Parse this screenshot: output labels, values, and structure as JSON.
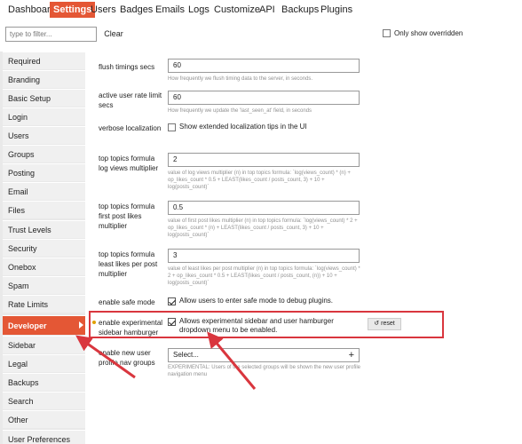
{
  "nav": {
    "tabs": [
      {
        "label": "Dashboard",
        "active": false
      },
      {
        "label": "Settings",
        "active": true
      },
      {
        "label": "Users",
        "active": false
      },
      {
        "label": "Badges",
        "active": false
      },
      {
        "label": "Emails",
        "active": false
      },
      {
        "label": "Logs",
        "active": false
      },
      {
        "label": "Customize",
        "active": false
      },
      {
        "label": "API",
        "active": false
      },
      {
        "label": "Backups",
        "active": false
      },
      {
        "label": "Plugins",
        "active": false
      }
    ]
  },
  "filter": {
    "placeholder": "type to filter...",
    "clear_label": "Clear",
    "only_overridden_label": "Only show overridden",
    "only_overridden_checked": false
  },
  "sidebar": {
    "items": [
      {
        "label": "Required"
      },
      {
        "label": "Branding"
      },
      {
        "label": "Basic Setup"
      },
      {
        "label": "Login"
      },
      {
        "label": "Users"
      },
      {
        "label": "Groups"
      },
      {
        "label": "Posting"
      },
      {
        "label": "Email"
      },
      {
        "label": "Files"
      },
      {
        "label": "Trust Levels"
      },
      {
        "label": "Security"
      },
      {
        "label": "Onebox"
      },
      {
        "label": "Spam"
      },
      {
        "label": "Rate Limits"
      },
      {
        "label": "Developer",
        "active": true
      },
      {
        "label": "Sidebar"
      },
      {
        "label": "Legal"
      },
      {
        "label": "Backups"
      },
      {
        "label": "Search"
      },
      {
        "label": "Other"
      },
      {
        "label": "User Preferences"
      }
    ]
  },
  "settings": {
    "flush_timings": {
      "label": "flush timings secs",
      "value": "60",
      "description": "How frequently we flush timing data to the server, in seconds."
    },
    "rate_limit": {
      "label": "active user rate limit secs",
      "value": "60",
      "description": "How frequently we update the 'last_seen_at' field, in seconds"
    },
    "verbose_localization": {
      "label": "verbose localization",
      "checkbox_label": "Show extended localization tips in the UI",
      "checked": false
    },
    "views_multiplier": {
      "label": "top topics formula log views multiplier",
      "value": "2",
      "description": "value of log views multiplier (n) in top topics formula: `log(views_count) * (n) + op_likes_count * 0.5 + LEAST(likes_count / posts_count, 3) + 10 + log(posts_count)`"
    },
    "first_post_likes": {
      "label": "top topics formula first post likes multiplier",
      "value": "0.5",
      "description": "value of first post likes multiplier (n) in top topics formula: `log(views_count) * 2 + op_likes_count * (n) + LEAST(likes_count / posts_count, 3) + 10 + log(posts_count)`"
    },
    "least_likes": {
      "label": "top topics formula least likes per post multiplier",
      "value": "3",
      "description": "value of least likes per post multiplier (n) in top topics formula: `log(views_count) * 2 + op_likes_count * 0.5 + LEAST(likes_count / posts_count, (n)) + 10 + log(posts_count)`"
    },
    "safe_mode": {
      "label": "enable safe mode",
      "checkbox_label": "Allow users to enter safe mode to debug plugins.",
      "checked": true
    },
    "experimental_sidebar": {
      "label": "enable experimental sidebar hamburger",
      "checkbox_label": "Allows experimental sidebar and user hamburger dropdown menu to be enabled.",
      "checked": true,
      "reset_label": "reset"
    },
    "profile_nav": {
      "label": "enable new user profile nav groups",
      "select_value": "Select...",
      "description": "EXPERIMENTAL: Users of the selected groups will be shown the new user profile navigation menu"
    }
  },
  "colors": {
    "accent": "#e45735",
    "annotation": "#d9363e"
  }
}
